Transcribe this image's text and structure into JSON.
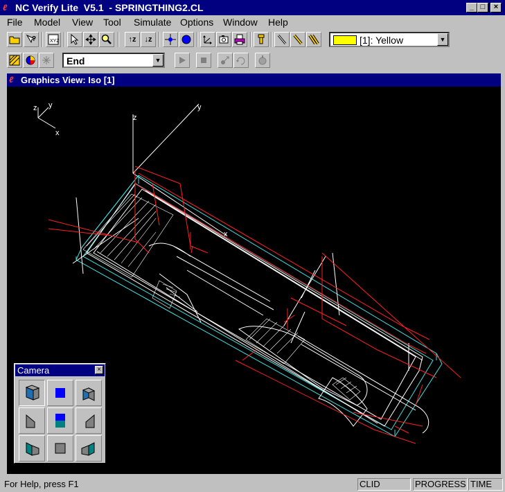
{
  "window": {
    "title": "NC Verify Lite  V5.1  - SPRINGTHING2.CL",
    "controls": [
      "_",
      "□",
      "×"
    ]
  },
  "menu": [
    "File",
    "Model",
    "View",
    "Tool",
    "Simulate",
    "Options",
    "Window",
    "Help"
  ],
  "toolbar": {
    "color_select": {
      "value": "[1]: Yellow",
      "swatch_color": "#ffff00"
    },
    "step_select": {
      "value": "End"
    }
  },
  "graphics_view": {
    "title": "Graphics View: Iso [1]",
    "triad": {
      "z": "z",
      "y": "y",
      "x": "x"
    },
    "axes": {
      "z": "z",
      "y": "y",
      "x": "x"
    }
  },
  "camera_panel": {
    "title": "Camera",
    "close": "×"
  },
  "statusbar": {
    "help": "For Help, press F1",
    "panels": [
      "CLID",
      "PROGRESS",
      "TIME"
    ]
  },
  "colors": {
    "titlebar": "#000080",
    "stock": "#40e0e0",
    "toolpath": "#ff2020",
    "part": "#ffffff",
    "button_face": "#c0c0c0"
  }
}
